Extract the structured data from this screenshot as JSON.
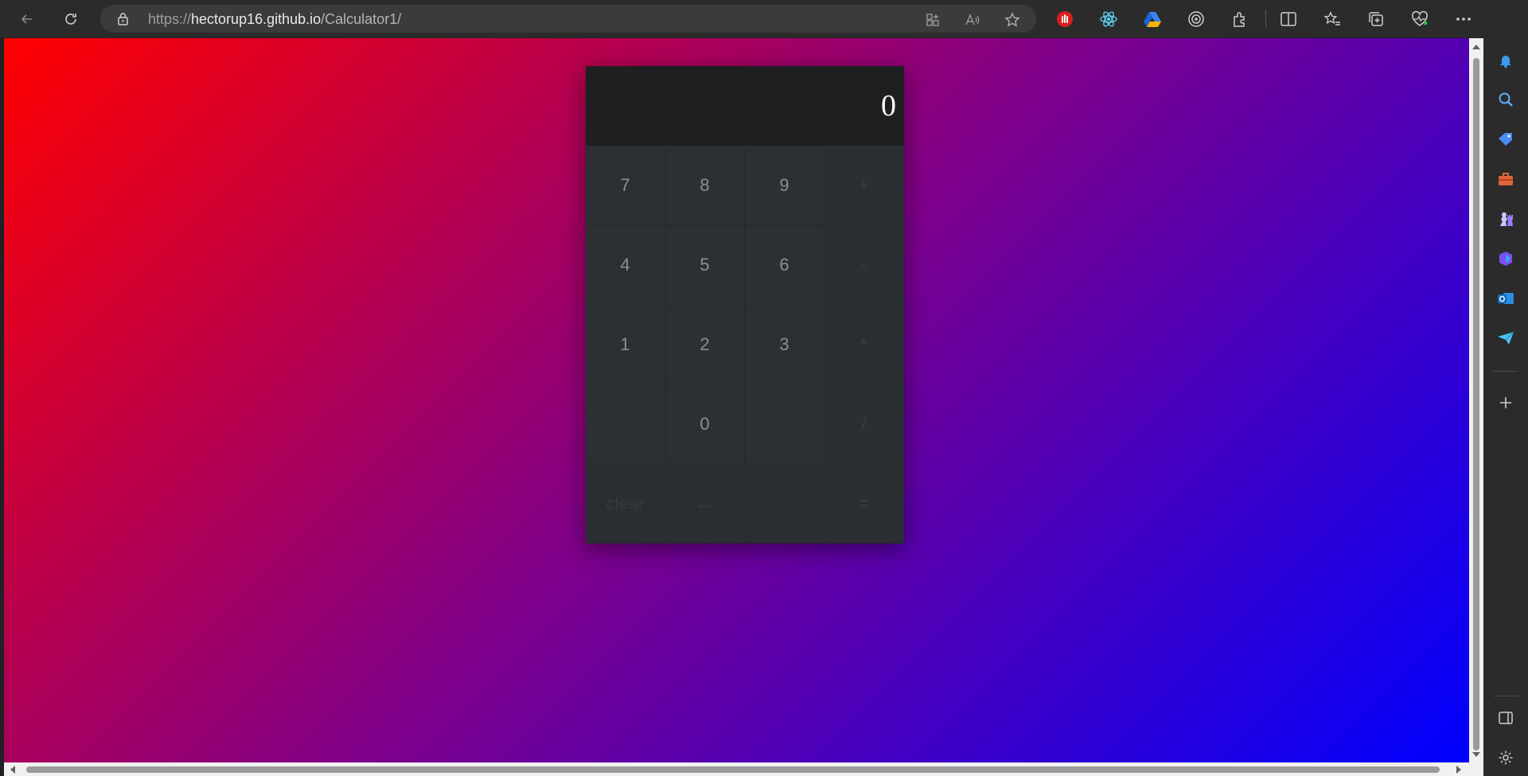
{
  "browser": {
    "url_scheme": "https://",
    "url_host": "hectorup16.github.io",
    "url_path": "/Calculator1/"
  },
  "calculator": {
    "display": "0",
    "rows": [
      [
        "7",
        "8",
        "9",
        "+"
      ],
      [
        "4",
        "5",
        "6",
        "-"
      ],
      [
        "1",
        "2",
        "3",
        "*"
      ],
      [
        "",
        "0",
        "",
        "/"
      ],
      [
        "clear",
        "←",
        "",
        "="
      ]
    ]
  },
  "icons": {
    "toolbar": [
      "back-icon",
      "refresh-icon",
      "lock-icon",
      "apps-icon",
      "read-aloud-icon",
      "favorite-star-icon",
      "extension-red-icon",
      "react-icon",
      "drive-icon",
      "target-icon",
      "extensions-puzzle-icon",
      "split-screen-icon",
      "favorites-icon",
      "collections-icon",
      "health-icon",
      "more-icon",
      "copilot-icon"
    ],
    "sidebar": [
      "bell-icon",
      "search-icon",
      "tag-icon",
      "toolbox-icon",
      "chess-icon",
      "office-icon",
      "outlook-icon",
      "send-icon",
      "add-icon",
      "sidebar-toggle-icon",
      "settings-icon"
    ]
  }
}
